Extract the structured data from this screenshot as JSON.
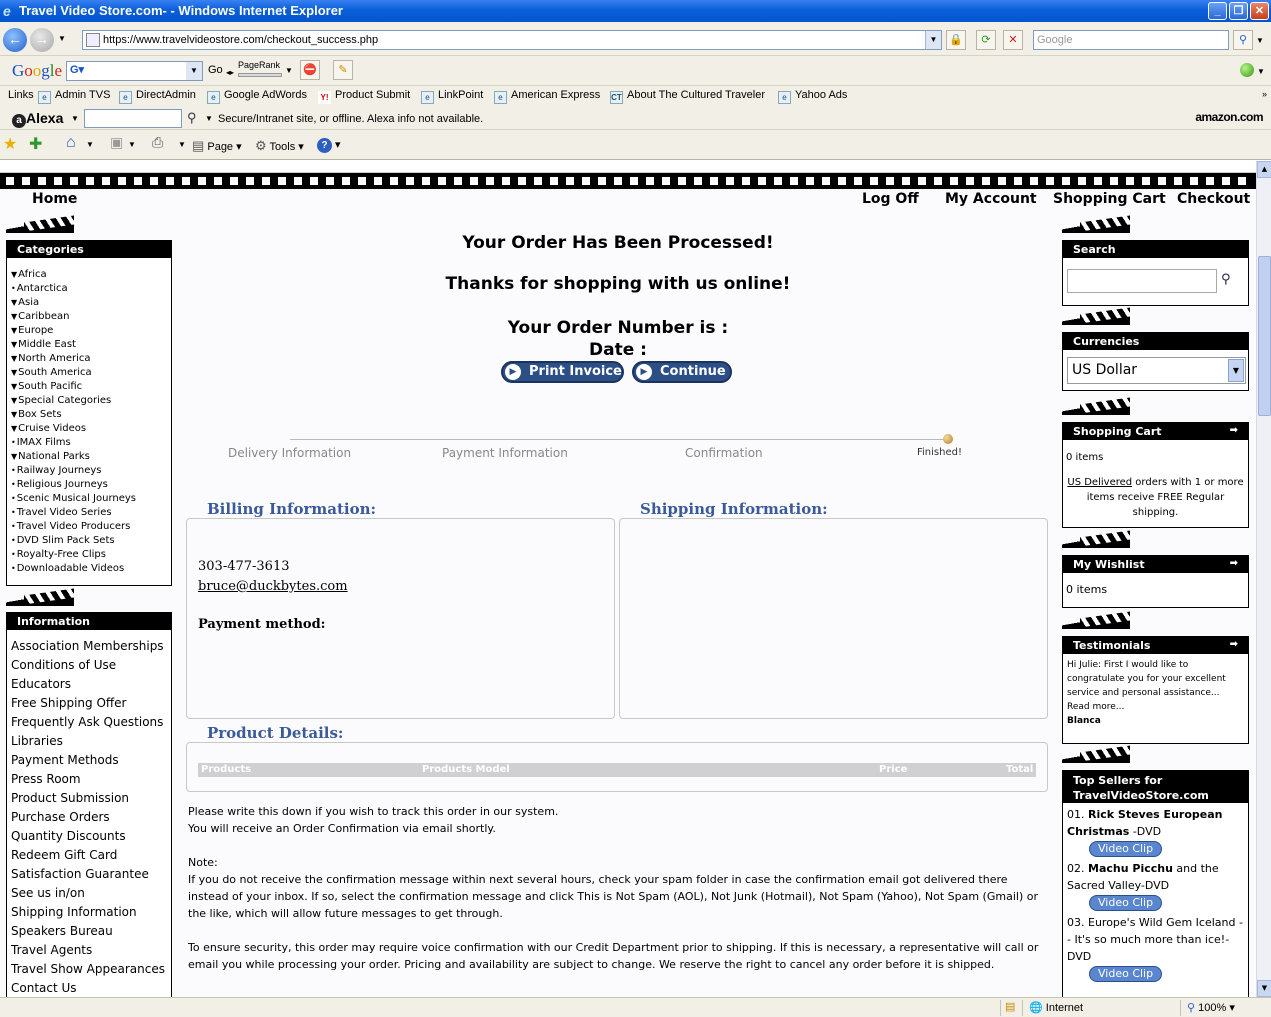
{
  "window": {
    "title": "Travel Video Store.com- - Windows Internet Explorer"
  },
  "browser": {
    "url": "https://www.travelvideostore.com/checkout_success.php",
    "search_placeholder": "Google",
    "google_go": "Go",
    "pagerank": "PageRank",
    "links_label": "Links",
    "links": [
      "Admin TVS",
      "DirectAdmin",
      "Google AdWords",
      "Product Submit",
      "LinkPoint",
      "American Express",
      "About The Cultured Traveler",
      "Yahoo Ads"
    ],
    "alexa": "Alexa",
    "alexa_msg": "Secure/Intranet site, or offline. Alexa info not available.",
    "amazon": "amazon.com",
    "page_menu": "Page",
    "tools_menu": "Tools"
  },
  "status": {
    "zone": "Internet",
    "zoom": "100%"
  },
  "topnav": {
    "home": "Home",
    "logoff": "Log Off",
    "account": "My Account",
    "cart": "Shopping Cart",
    "checkout": "Checkout"
  },
  "sidebar_left": {
    "categories_title": "Categories",
    "categories": [
      {
        "label": "Africa",
        "mark": "▼"
      },
      {
        "label": "Antarctica",
        "mark": "•"
      },
      {
        "label": "Asia",
        "mark": "▼"
      },
      {
        "label": "Caribbean",
        "mark": "▼"
      },
      {
        "label": "Europe",
        "mark": "▼"
      },
      {
        "label": "Middle East",
        "mark": "▼"
      },
      {
        "label": "North America",
        "mark": "▼"
      },
      {
        "label": "South America",
        "mark": "▼"
      },
      {
        "label": "South Pacific",
        "mark": "▼"
      },
      {
        "label": "Special Categories",
        "mark": "▼"
      },
      {
        "label": "Box Sets",
        "mark": "▼"
      },
      {
        "label": "Cruise Videos",
        "mark": "▼"
      },
      {
        "label": "IMAX Films",
        "mark": "•"
      },
      {
        "label": "National Parks",
        "mark": "▼"
      },
      {
        "label": "Railway Journeys",
        "mark": "•"
      },
      {
        "label": "Religious Journeys",
        "mark": "•"
      },
      {
        "label": "Scenic Musical Journeys",
        "mark": "•"
      },
      {
        "label": "Travel Video Series",
        "mark": "•"
      },
      {
        "label": "Travel Video Producers",
        "mark": "•"
      },
      {
        "label": "DVD Slim Pack Sets",
        "mark": "•"
      },
      {
        "label": "Royalty-Free Clips",
        "mark": "•"
      },
      {
        "label": "Downloadable Videos",
        "mark": "•"
      }
    ],
    "info_title": "Information",
    "info": [
      "Association Memberships",
      "Conditions of Use",
      "Educators",
      "Free Shipping Offer",
      "Frequently Ask Questions",
      "Libraries",
      "Payment Methods",
      "Press Room",
      "Product Submission",
      "Purchase Orders",
      "Quantity Discounts",
      "Redeem Gift Card",
      "Satisfaction Guarantee",
      "See us in/on",
      "Shipping Information",
      "Speakers Bureau",
      "Travel Agents",
      "Travel Show Appearances",
      "Contact Us"
    ]
  },
  "main": {
    "heading": "Your Order Has Been Processed!",
    "thanks": "Thanks for shopping with us online!",
    "order_number": "Your Order Number is :",
    "date": "Date :",
    "print_btn": "Print Invoice",
    "continue_btn": "Continue",
    "steps": [
      "Delivery Information",
      "Payment Information",
      "Confirmation",
      "Finished!"
    ],
    "billing_title": "Billing Information:",
    "shipping_title": "Shipping Information:",
    "phone": "303-477-3613",
    "email": "bruce@duckbytes.com",
    "payment_method": "Payment method:",
    "product_title": "Product Details:",
    "product_cols": [
      "Products",
      "Products Model",
      "Price",
      "Total"
    ],
    "note1": "Please write this down if you wish to track this order in our system.",
    "note2": "You will receive an Order Confirmation via email shortly.",
    "note_label": "Note:",
    "note3": "If you do not receive the confirmation message within next several hours, check your spam folder in case the confirmation email got delivered there instead of your inbox. If so, select the confirmation message and click This is Not Spam (AOL), Not Junk (Hotmail), Not Spam (Yahoo), Not Spam (Gmail) or the like, which will allow future messages to get through.",
    "note4": "To ensure security, this order may require voice confirmation with our Credit Department prior to shipping. If this is necessary, a representative will call or email you while processing your order. Pricing and availability are subject to change. We reserve the right to cancel any order before it is shipped."
  },
  "sidebar_right": {
    "search_title": "Search",
    "currencies_title": "Currencies",
    "currency": "US Dollar",
    "cart_title": "Shopping Cart",
    "cart_items": "0 items",
    "cart_link": "US Delivered",
    "cart_msg": "orders with 1 or more items receive FREE Regular shipping.",
    "wishlist_title": "My Wishlist",
    "wishlist_items": "0 items",
    "testimonials_title": "Testimonials",
    "testimonial": "Hi Julie: First I would like to congratulate you for your excellent service and personal assistance...",
    "read_more": "Read more...",
    "testimonial_author": "Blanca",
    "top_title_1": "Top Sellers for",
    "top_title_2": "TravelVideoStore.com",
    "top": [
      {
        "num": "01.",
        "bold": "Rick Steves European Christmas",
        "rest": " -DVD"
      },
      {
        "num": "02.",
        "bold": "Machu Picchu",
        "rest": " and the Sacred Valley-DVD"
      },
      {
        "num": "03.",
        "bold": "",
        "rest": "Europe's Wild Gem Iceland -- It's so much more than ice!-DVD"
      }
    ],
    "video_clip": "Video Clip"
  }
}
